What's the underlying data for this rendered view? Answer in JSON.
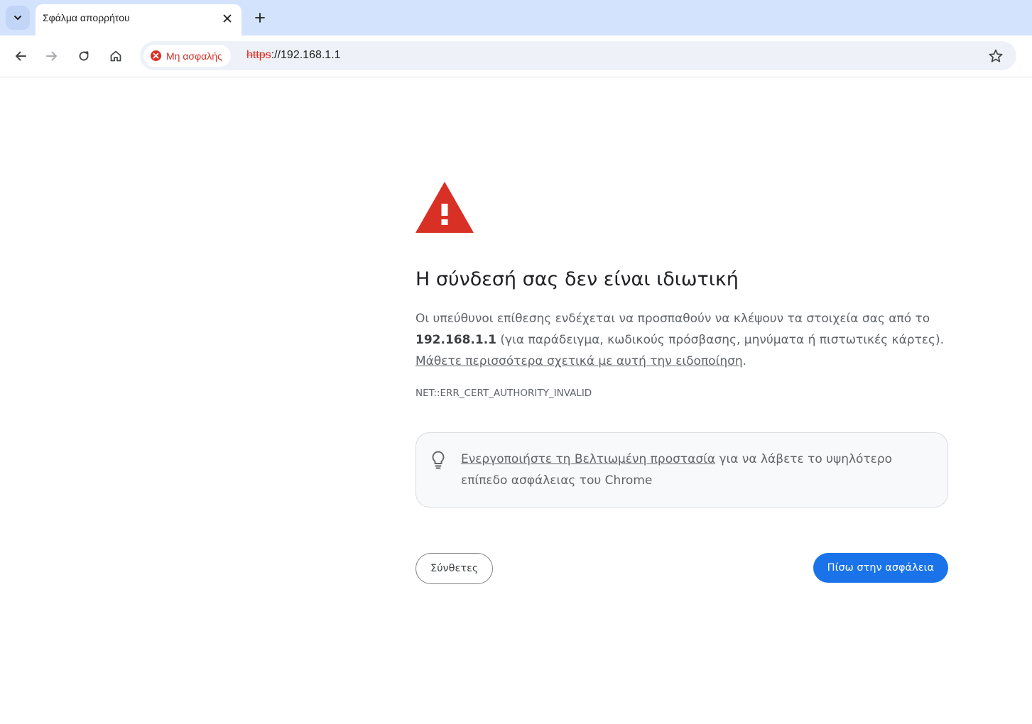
{
  "browser": {
    "tab": {
      "title": "Σφάλμα απορρήτου"
    },
    "toolbar": {
      "security_chip": "Μη ασφαλής",
      "url_scheme": "https",
      "url_rest": "://192.168.1.1"
    }
  },
  "page": {
    "heading": "Η σύνδεσή σας δεν είναι ιδιωτική",
    "para": {
      "intro": "Οι υπεύθυνοι επίθεσης ενδέχεται να προσπαθούν να κλέψουν τα στοιχεία σας από το ",
      "host": "192.168.1.1",
      "examples": " (για παράδειγμα, κωδικούς πρόσβασης, μηνύματα ή πιστωτικές κάρτες). ",
      "learn_more": "Μάθετε περισσότερα σχετικά με αυτή την ειδοποίηση",
      "end": "."
    },
    "error_code": "NET::ERR_CERT_AUTHORITY_INVALID",
    "promo": {
      "link": "Ενεργοποιήστε τη Βελτιωμένη προστασία",
      "rest": " για να λάβετε το υψηλότερο επίπεδο ασφάλειας του Chrome"
    },
    "buttons": {
      "advanced": "Σύνθετες",
      "back_to_safety": "Πίσω στην ασφάλεια"
    }
  },
  "colors": {
    "danger": "#d93025",
    "primary": "#1a73e8",
    "tabstrip": "#d3e3fd"
  }
}
